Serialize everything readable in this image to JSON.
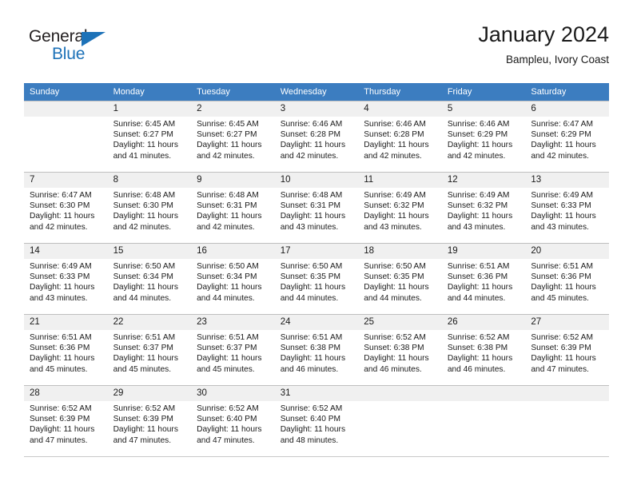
{
  "brand": {
    "name_part1": "General",
    "name_part2": "Blue",
    "triangle_color": "#1d72b8"
  },
  "header": {
    "title": "January 2024",
    "subtitle": "Bampleu, Ivory Coast",
    "header_bg": "#3c7dc0",
    "daynum_bg": "#f0f0f0"
  },
  "weekdays": [
    "Sunday",
    "Monday",
    "Tuesday",
    "Wednesday",
    "Thursday",
    "Friday",
    "Saturday"
  ],
  "weeks": [
    [
      {
        "day": "",
        "sunrise": "",
        "sunset": "",
        "daylight_line1": "",
        "daylight_line2": ""
      },
      {
        "day": "1",
        "sunrise": "Sunrise: 6:45 AM",
        "sunset": "Sunset: 6:27 PM",
        "daylight_line1": "Daylight: 11 hours",
        "daylight_line2": "and 41 minutes."
      },
      {
        "day": "2",
        "sunrise": "Sunrise: 6:45 AM",
        "sunset": "Sunset: 6:27 PM",
        "daylight_line1": "Daylight: 11 hours",
        "daylight_line2": "and 42 minutes."
      },
      {
        "day": "3",
        "sunrise": "Sunrise: 6:46 AM",
        "sunset": "Sunset: 6:28 PM",
        "daylight_line1": "Daylight: 11 hours",
        "daylight_line2": "and 42 minutes."
      },
      {
        "day": "4",
        "sunrise": "Sunrise: 6:46 AM",
        "sunset": "Sunset: 6:28 PM",
        "daylight_line1": "Daylight: 11 hours",
        "daylight_line2": "and 42 minutes."
      },
      {
        "day": "5",
        "sunrise": "Sunrise: 6:46 AM",
        "sunset": "Sunset: 6:29 PM",
        "daylight_line1": "Daylight: 11 hours",
        "daylight_line2": "and 42 minutes."
      },
      {
        "day": "6",
        "sunrise": "Sunrise: 6:47 AM",
        "sunset": "Sunset: 6:29 PM",
        "daylight_line1": "Daylight: 11 hours",
        "daylight_line2": "and 42 minutes."
      }
    ],
    [
      {
        "day": "7",
        "sunrise": "Sunrise: 6:47 AM",
        "sunset": "Sunset: 6:30 PM",
        "daylight_line1": "Daylight: 11 hours",
        "daylight_line2": "and 42 minutes."
      },
      {
        "day": "8",
        "sunrise": "Sunrise: 6:48 AM",
        "sunset": "Sunset: 6:30 PM",
        "daylight_line1": "Daylight: 11 hours",
        "daylight_line2": "and 42 minutes."
      },
      {
        "day": "9",
        "sunrise": "Sunrise: 6:48 AM",
        "sunset": "Sunset: 6:31 PM",
        "daylight_line1": "Daylight: 11 hours",
        "daylight_line2": "and 42 minutes."
      },
      {
        "day": "10",
        "sunrise": "Sunrise: 6:48 AM",
        "sunset": "Sunset: 6:31 PM",
        "daylight_line1": "Daylight: 11 hours",
        "daylight_line2": "and 43 minutes."
      },
      {
        "day": "11",
        "sunrise": "Sunrise: 6:49 AM",
        "sunset": "Sunset: 6:32 PM",
        "daylight_line1": "Daylight: 11 hours",
        "daylight_line2": "and 43 minutes."
      },
      {
        "day": "12",
        "sunrise": "Sunrise: 6:49 AM",
        "sunset": "Sunset: 6:32 PM",
        "daylight_line1": "Daylight: 11 hours",
        "daylight_line2": "and 43 minutes."
      },
      {
        "day": "13",
        "sunrise": "Sunrise: 6:49 AM",
        "sunset": "Sunset: 6:33 PM",
        "daylight_line1": "Daylight: 11 hours",
        "daylight_line2": "and 43 minutes."
      }
    ],
    [
      {
        "day": "14",
        "sunrise": "Sunrise: 6:49 AM",
        "sunset": "Sunset: 6:33 PM",
        "daylight_line1": "Daylight: 11 hours",
        "daylight_line2": "and 43 minutes."
      },
      {
        "day": "15",
        "sunrise": "Sunrise: 6:50 AM",
        "sunset": "Sunset: 6:34 PM",
        "daylight_line1": "Daylight: 11 hours",
        "daylight_line2": "and 44 minutes."
      },
      {
        "day": "16",
        "sunrise": "Sunrise: 6:50 AM",
        "sunset": "Sunset: 6:34 PM",
        "daylight_line1": "Daylight: 11 hours",
        "daylight_line2": "and 44 minutes."
      },
      {
        "day": "17",
        "sunrise": "Sunrise: 6:50 AM",
        "sunset": "Sunset: 6:35 PM",
        "daylight_line1": "Daylight: 11 hours",
        "daylight_line2": "and 44 minutes."
      },
      {
        "day": "18",
        "sunrise": "Sunrise: 6:50 AM",
        "sunset": "Sunset: 6:35 PM",
        "daylight_line1": "Daylight: 11 hours",
        "daylight_line2": "and 44 minutes."
      },
      {
        "day": "19",
        "sunrise": "Sunrise: 6:51 AM",
        "sunset": "Sunset: 6:36 PM",
        "daylight_line1": "Daylight: 11 hours",
        "daylight_line2": "and 44 minutes."
      },
      {
        "day": "20",
        "sunrise": "Sunrise: 6:51 AM",
        "sunset": "Sunset: 6:36 PM",
        "daylight_line1": "Daylight: 11 hours",
        "daylight_line2": "and 45 minutes."
      }
    ],
    [
      {
        "day": "21",
        "sunrise": "Sunrise: 6:51 AM",
        "sunset": "Sunset: 6:36 PM",
        "daylight_line1": "Daylight: 11 hours",
        "daylight_line2": "and 45 minutes."
      },
      {
        "day": "22",
        "sunrise": "Sunrise: 6:51 AM",
        "sunset": "Sunset: 6:37 PM",
        "daylight_line1": "Daylight: 11 hours",
        "daylight_line2": "and 45 minutes."
      },
      {
        "day": "23",
        "sunrise": "Sunrise: 6:51 AM",
        "sunset": "Sunset: 6:37 PM",
        "daylight_line1": "Daylight: 11 hours",
        "daylight_line2": "and 45 minutes."
      },
      {
        "day": "24",
        "sunrise": "Sunrise: 6:51 AM",
        "sunset": "Sunset: 6:38 PM",
        "daylight_line1": "Daylight: 11 hours",
        "daylight_line2": "and 46 minutes."
      },
      {
        "day": "25",
        "sunrise": "Sunrise: 6:52 AM",
        "sunset": "Sunset: 6:38 PM",
        "daylight_line1": "Daylight: 11 hours",
        "daylight_line2": "and 46 minutes."
      },
      {
        "day": "26",
        "sunrise": "Sunrise: 6:52 AM",
        "sunset": "Sunset: 6:38 PM",
        "daylight_line1": "Daylight: 11 hours",
        "daylight_line2": "and 46 minutes."
      },
      {
        "day": "27",
        "sunrise": "Sunrise: 6:52 AM",
        "sunset": "Sunset: 6:39 PM",
        "daylight_line1": "Daylight: 11 hours",
        "daylight_line2": "and 47 minutes."
      }
    ],
    [
      {
        "day": "28",
        "sunrise": "Sunrise: 6:52 AM",
        "sunset": "Sunset: 6:39 PM",
        "daylight_line1": "Daylight: 11 hours",
        "daylight_line2": "and 47 minutes."
      },
      {
        "day": "29",
        "sunrise": "Sunrise: 6:52 AM",
        "sunset": "Sunset: 6:39 PM",
        "daylight_line1": "Daylight: 11 hours",
        "daylight_line2": "and 47 minutes."
      },
      {
        "day": "30",
        "sunrise": "Sunrise: 6:52 AM",
        "sunset": "Sunset: 6:40 PM",
        "daylight_line1": "Daylight: 11 hours",
        "daylight_line2": "and 47 minutes."
      },
      {
        "day": "31",
        "sunrise": "Sunrise: 6:52 AM",
        "sunset": "Sunset: 6:40 PM",
        "daylight_line1": "Daylight: 11 hours",
        "daylight_line2": "and 48 minutes."
      },
      {
        "day": "",
        "sunrise": "",
        "sunset": "",
        "daylight_line1": "",
        "daylight_line2": ""
      },
      {
        "day": "",
        "sunrise": "",
        "sunset": "",
        "daylight_line1": "",
        "daylight_line2": ""
      },
      {
        "day": "",
        "sunrise": "",
        "sunset": "",
        "daylight_line1": "",
        "daylight_line2": ""
      }
    ]
  ]
}
